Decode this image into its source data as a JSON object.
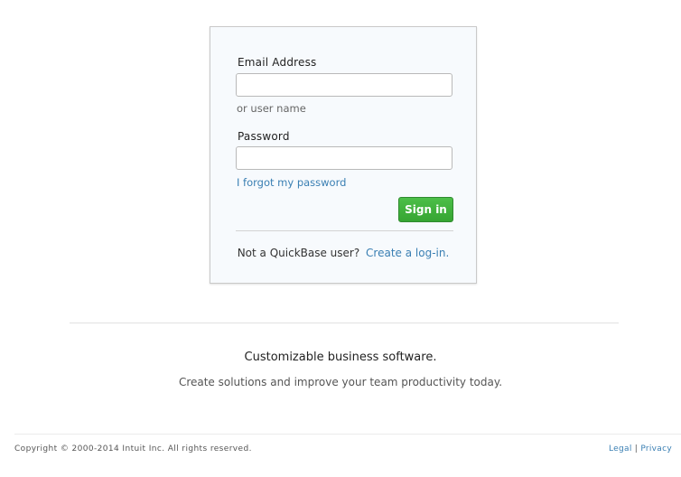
{
  "login": {
    "email_label": "Email Address",
    "email_value": "",
    "username_hint": "or user name",
    "password_label": "Password",
    "password_value": "",
    "forgot_link": "I forgot my password",
    "signin_label": "Sign in",
    "not_user_text": "Not a QuickBase user?",
    "create_link": "Create a log-in."
  },
  "marketing": {
    "tagline": "Customizable business software.",
    "subtagline": "Create solutions and improve your team productivity today."
  },
  "footer": {
    "copyright": "Copyright © 2000-2014 Intuit Inc. All rights reserved.",
    "legal_link": "Legal",
    "separator": "|",
    "privacy_link": "Privacy"
  },
  "colors": {
    "link": "#3a7fb3",
    "signin_button": "#3cae37",
    "card_background": "#f7fafd"
  }
}
